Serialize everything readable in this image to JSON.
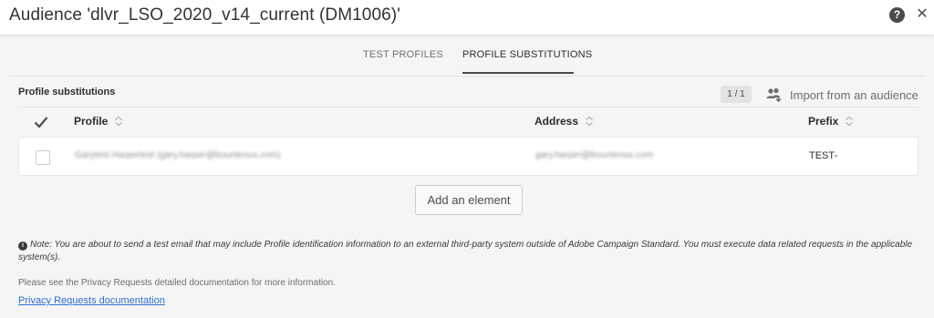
{
  "window": {
    "title": "Audience 'dlvr_LSO_2020_v14_current (DM1006)'",
    "help_glyph": "?",
    "close_glyph": "✕"
  },
  "tabs": [
    {
      "label": "TEST PROFILES",
      "active": false
    },
    {
      "label": "PROFILE SUBSTITUTIONS",
      "active": true
    }
  ],
  "section": {
    "title": "Profile substitutions",
    "pager": "1 / 1",
    "import_label": "Import from an audience",
    "import_icon": "users-import-icon"
  },
  "table": {
    "columns": [
      "Profile",
      "Address",
      "Prefix"
    ],
    "rows": [
      {
        "profile": "Garytest Harpertest (gary.harper@bounteous.com)",
        "address": "gary.harper@bounteous.com",
        "prefix": "TEST-",
        "checked": false
      }
    ]
  },
  "add_button_label": "Add an element",
  "note": {
    "icon_glyph": "i",
    "text": "Note: You are about to send a test email that may include Profile identification information to an external third-party system outside of Adobe Campaign Standard. You must execute data related requests in the applicable system(s)."
  },
  "privacy": {
    "see_text": "Please see the Privacy Requests detailed documentation for more information.",
    "link_label": "Privacy Requests documentation"
  },
  "colors": {
    "background": "#f5f5f5",
    "header": "#ffffff",
    "link": "#2d6fd0",
    "text": "#2c2c2c"
  }
}
